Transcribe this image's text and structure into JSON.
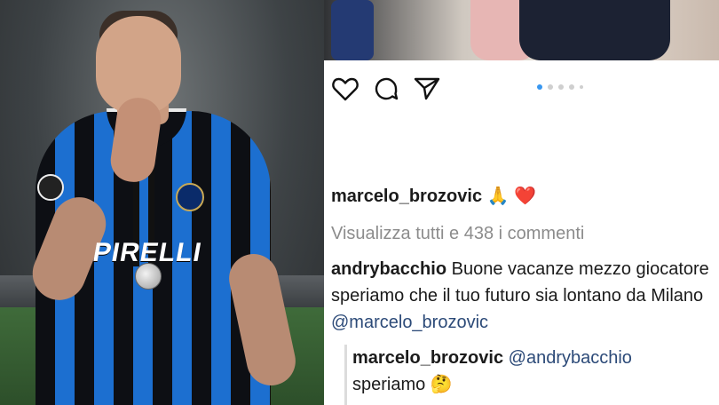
{
  "post": {
    "owner_username": "marcelo_brozovic",
    "owner_emojis": "🙏 ❤️",
    "view_comments": "Visualizza tutti e 438 i commenti",
    "comment": {
      "username": "andrybacchio",
      "text": "Buone vacanze mezzo giocatore speriamo che il tuo futuro sia lontano da Milano",
      "mention": "@marcelo_brozovic"
    },
    "reply": {
      "username": "marcelo_brozovic",
      "mention": "@andrybacchio",
      "text": "speriamo",
      "emoji": "🤔"
    }
  },
  "photo_left": {
    "jersey_sponsor": "PIRELLI"
  },
  "icons": {
    "like": "heart-icon",
    "comment": "comment-icon",
    "share": "send-icon"
  },
  "carousel": {
    "total_dots": 5,
    "active_index": 0
  },
  "colors": {
    "instagram_blue": "#3897f0",
    "mention_blue": "#2c4a78",
    "muted_gray": "#8c8c8c",
    "inter_blue": "#1c6fd0"
  }
}
